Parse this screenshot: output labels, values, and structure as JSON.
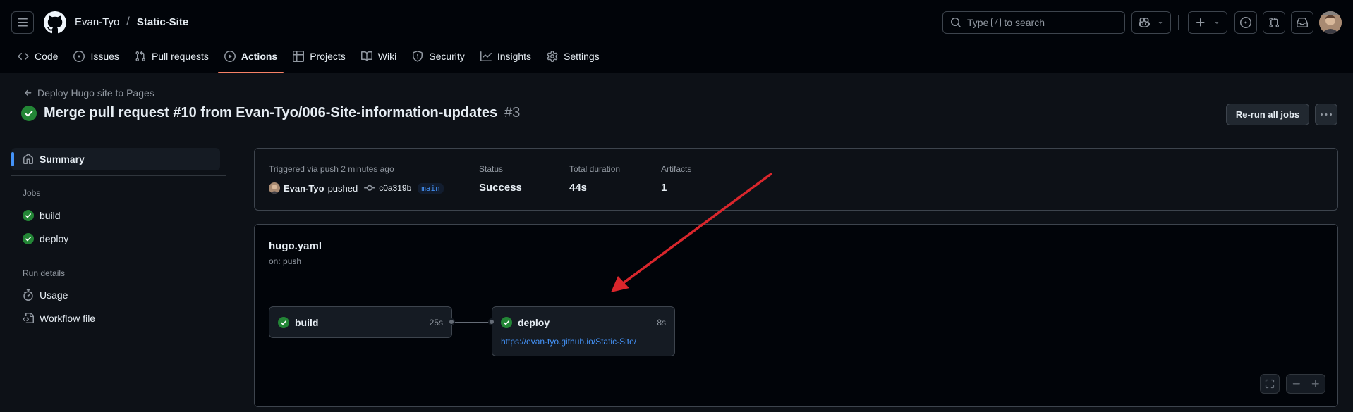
{
  "header": {
    "owner": "Evan-Tyo",
    "separator": "/",
    "repo": "Static-Site",
    "search_prefix": "Type",
    "search_key": "/",
    "search_suffix": "to search"
  },
  "tabs": [
    {
      "label": "Code",
      "icon": "code-icon"
    },
    {
      "label": "Issues",
      "icon": "issue-icon"
    },
    {
      "label": "Pull requests",
      "icon": "pull-request-icon"
    },
    {
      "label": "Actions",
      "icon": "play-icon",
      "active": true
    },
    {
      "label": "Projects",
      "icon": "table-icon"
    },
    {
      "label": "Wiki",
      "icon": "book-icon"
    },
    {
      "label": "Security",
      "icon": "shield-icon"
    },
    {
      "label": "Insights",
      "icon": "graph-icon"
    },
    {
      "label": "Settings",
      "icon": "gear-icon"
    }
  ],
  "page": {
    "back_label": "Deploy Hugo site to Pages",
    "title": "Merge pull request #10 from Evan-Tyo/006-Site-information-updates",
    "run_number": "#3",
    "rerun_label": "Re-run all jobs"
  },
  "sidebar": {
    "summary_label": "Summary",
    "jobs_heading": "Jobs",
    "jobs": [
      "build",
      "deploy"
    ],
    "run_details_heading": "Run details",
    "usage_label": "Usage",
    "workflow_file_label": "Workflow file"
  },
  "summary": {
    "trigger_label": "Triggered via push 2 minutes ago",
    "actor": "Evan-Tyo",
    "pushed_text": "pushed",
    "commit": "c0a319b",
    "branch": "main",
    "status_label": "Status",
    "status_value": "Success",
    "duration_label": "Total duration",
    "duration_value": "44s",
    "artifacts_label": "Artifacts",
    "artifacts_value": "1"
  },
  "workflow": {
    "file": "hugo.yaml",
    "trigger": "on: push",
    "jobs": [
      {
        "name": "build",
        "duration": "25s",
        "status": "success"
      },
      {
        "name": "deploy",
        "duration": "8s",
        "status": "success",
        "url": "https://evan-tyo.github.io/Static-Site/"
      }
    ]
  },
  "colors": {
    "success": "#238636",
    "accent": "#f78166",
    "link": "#4493f8",
    "annotation_arrow": "#d9262c"
  }
}
